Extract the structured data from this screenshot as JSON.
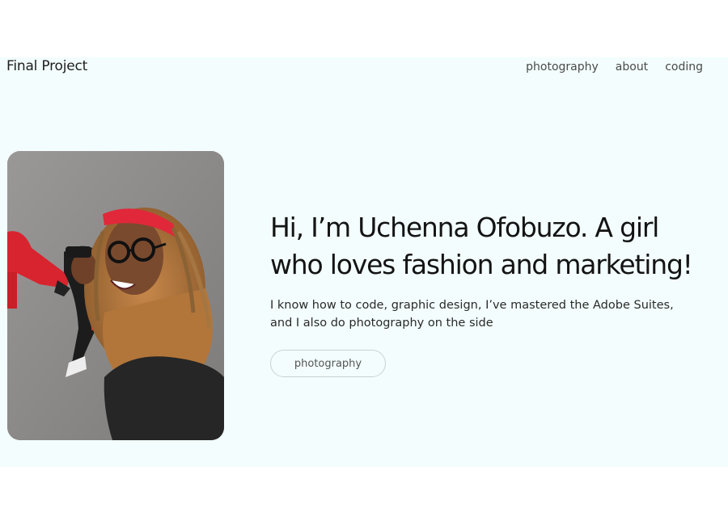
{
  "header": {
    "brand": "Final Project",
    "nav": [
      "photography",
      "about",
      "coding"
    ]
  },
  "hero": {
    "headline_line1": "Hi, I’m Uchenna Ofobuzo. A girl",
    "headline_line2": "who loves fashion and marketing!",
    "description_line1": "I know how to code, graphic design, I’ve mastered the Adobe Suites,",
    "description_line2": "and I also do photography on the side",
    "cta_label": "photography"
  },
  "colors": {
    "page_background": "#f3fdfd",
    "text_primary": "#141414",
    "nav_text": "#4a4a4a",
    "button_border": "#c8d2d2"
  }
}
